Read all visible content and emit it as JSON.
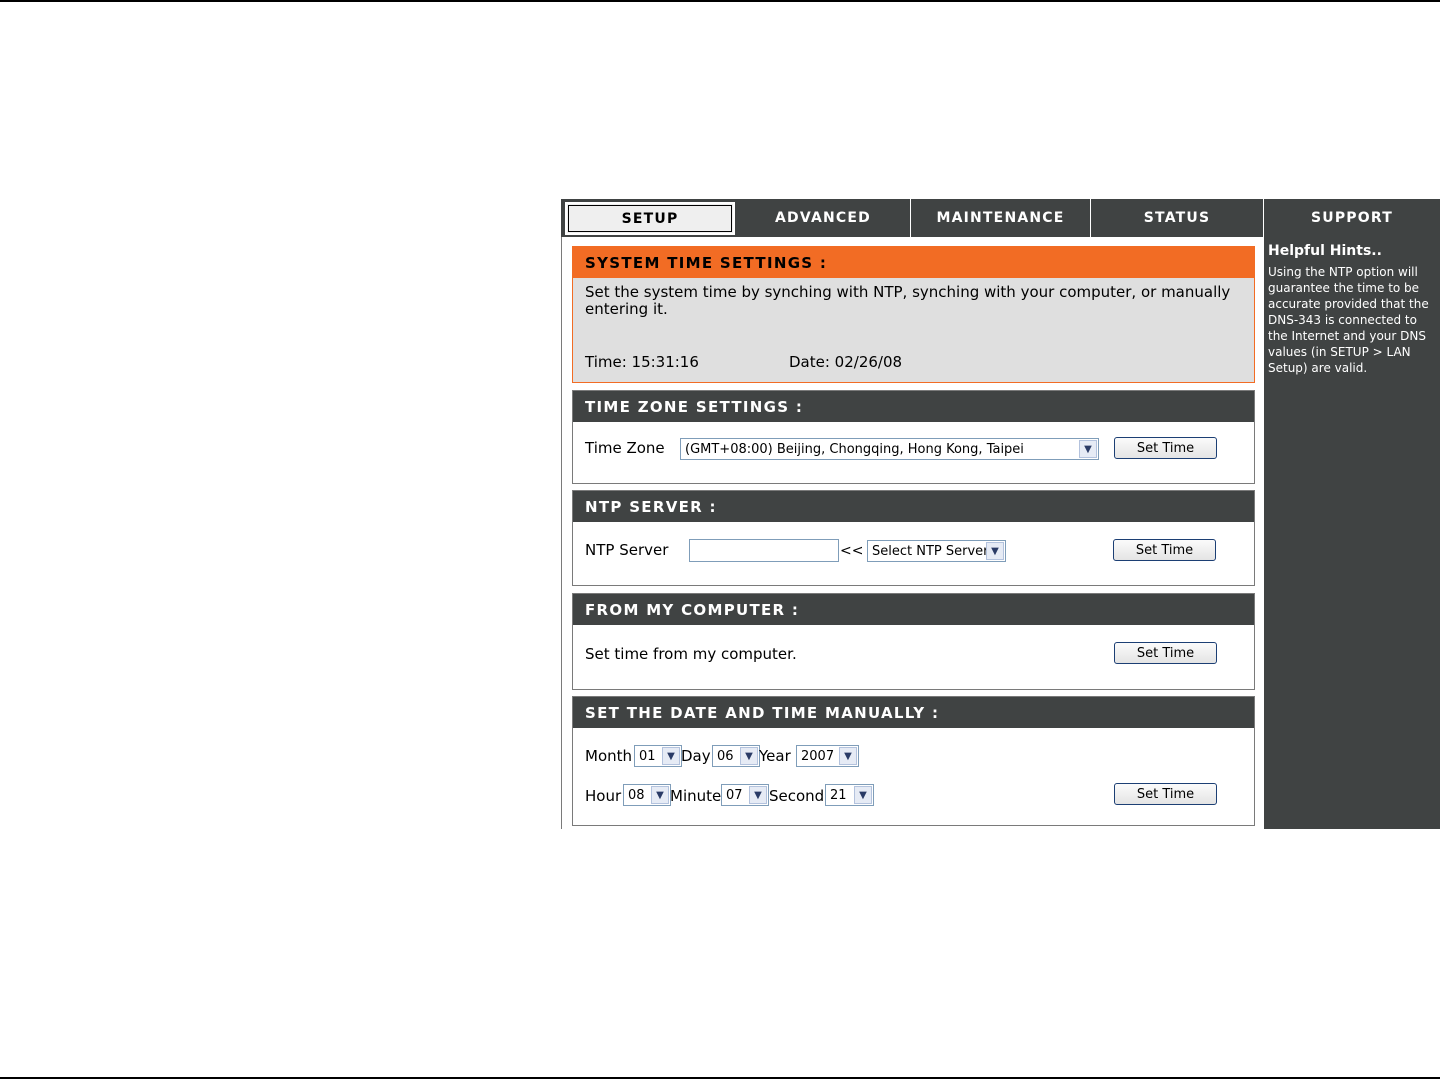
{
  "tabs": [
    {
      "label": "SETUP",
      "active": true
    },
    {
      "label": "ADVANCED",
      "active": false
    },
    {
      "label": "MAINTENANCE",
      "active": false
    },
    {
      "label": "STATUS",
      "active": false
    },
    {
      "label": "SUPPORT",
      "active": false
    }
  ],
  "hints": {
    "title": "Helpful Hints..",
    "text": "Using the NTP option will guarantee the time to be accurate provided that the DNS-343 is connected to the Internet and your DNS values (in SETUP > LAN Setup) are valid."
  },
  "system_time": {
    "title": "SYSTEM TIME SETTINGS :",
    "description": "Set the system time by synching with NTP, synching with your computer, or manually entering it.",
    "time_label": "Time: 15:31:16",
    "date_label": "Date: 02/26/08"
  },
  "time_zone": {
    "title": "TIME ZONE SETTINGS :",
    "label": "Time Zone",
    "selected": "(GMT+08:00) Beijing, Chongqing, Hong Kong, Taipei",
    "button": "Set Time"
  },
  "ntp": {
    "title": "NTP SERVER :",
    "label": "NTP Server",
    "input_value": "",
    "separator": "<<",
    "select": "Select NTP Server",
    "button": "Set Time"
  },
  "computer": {
    "title": "FROM MY COMPUTER :",
    "text": "Set time from my computer.",
    "button": "Set Time"
  },
  "manual": {
    "title": "SET THE DATE AND TIME MANUALLY :",
    "month_label": "Month",
    "month": "01",
    "day_label": "Day",
    "day": "06",
    "year_label": "Year",
    "year": "2007",
    "hour_label": "Hour",
    "hour": "08",
    "minute_label": "Minute",
    "minute": "07",
    "second_label": "Second",
    "second": "21",
    "button": "Set Time"
  },
  "colors": {
    "accent_orange": "#f26c24",
    "dark_header": "#404343",
    "panel_gray": "#dfdfdf"
  }
}
